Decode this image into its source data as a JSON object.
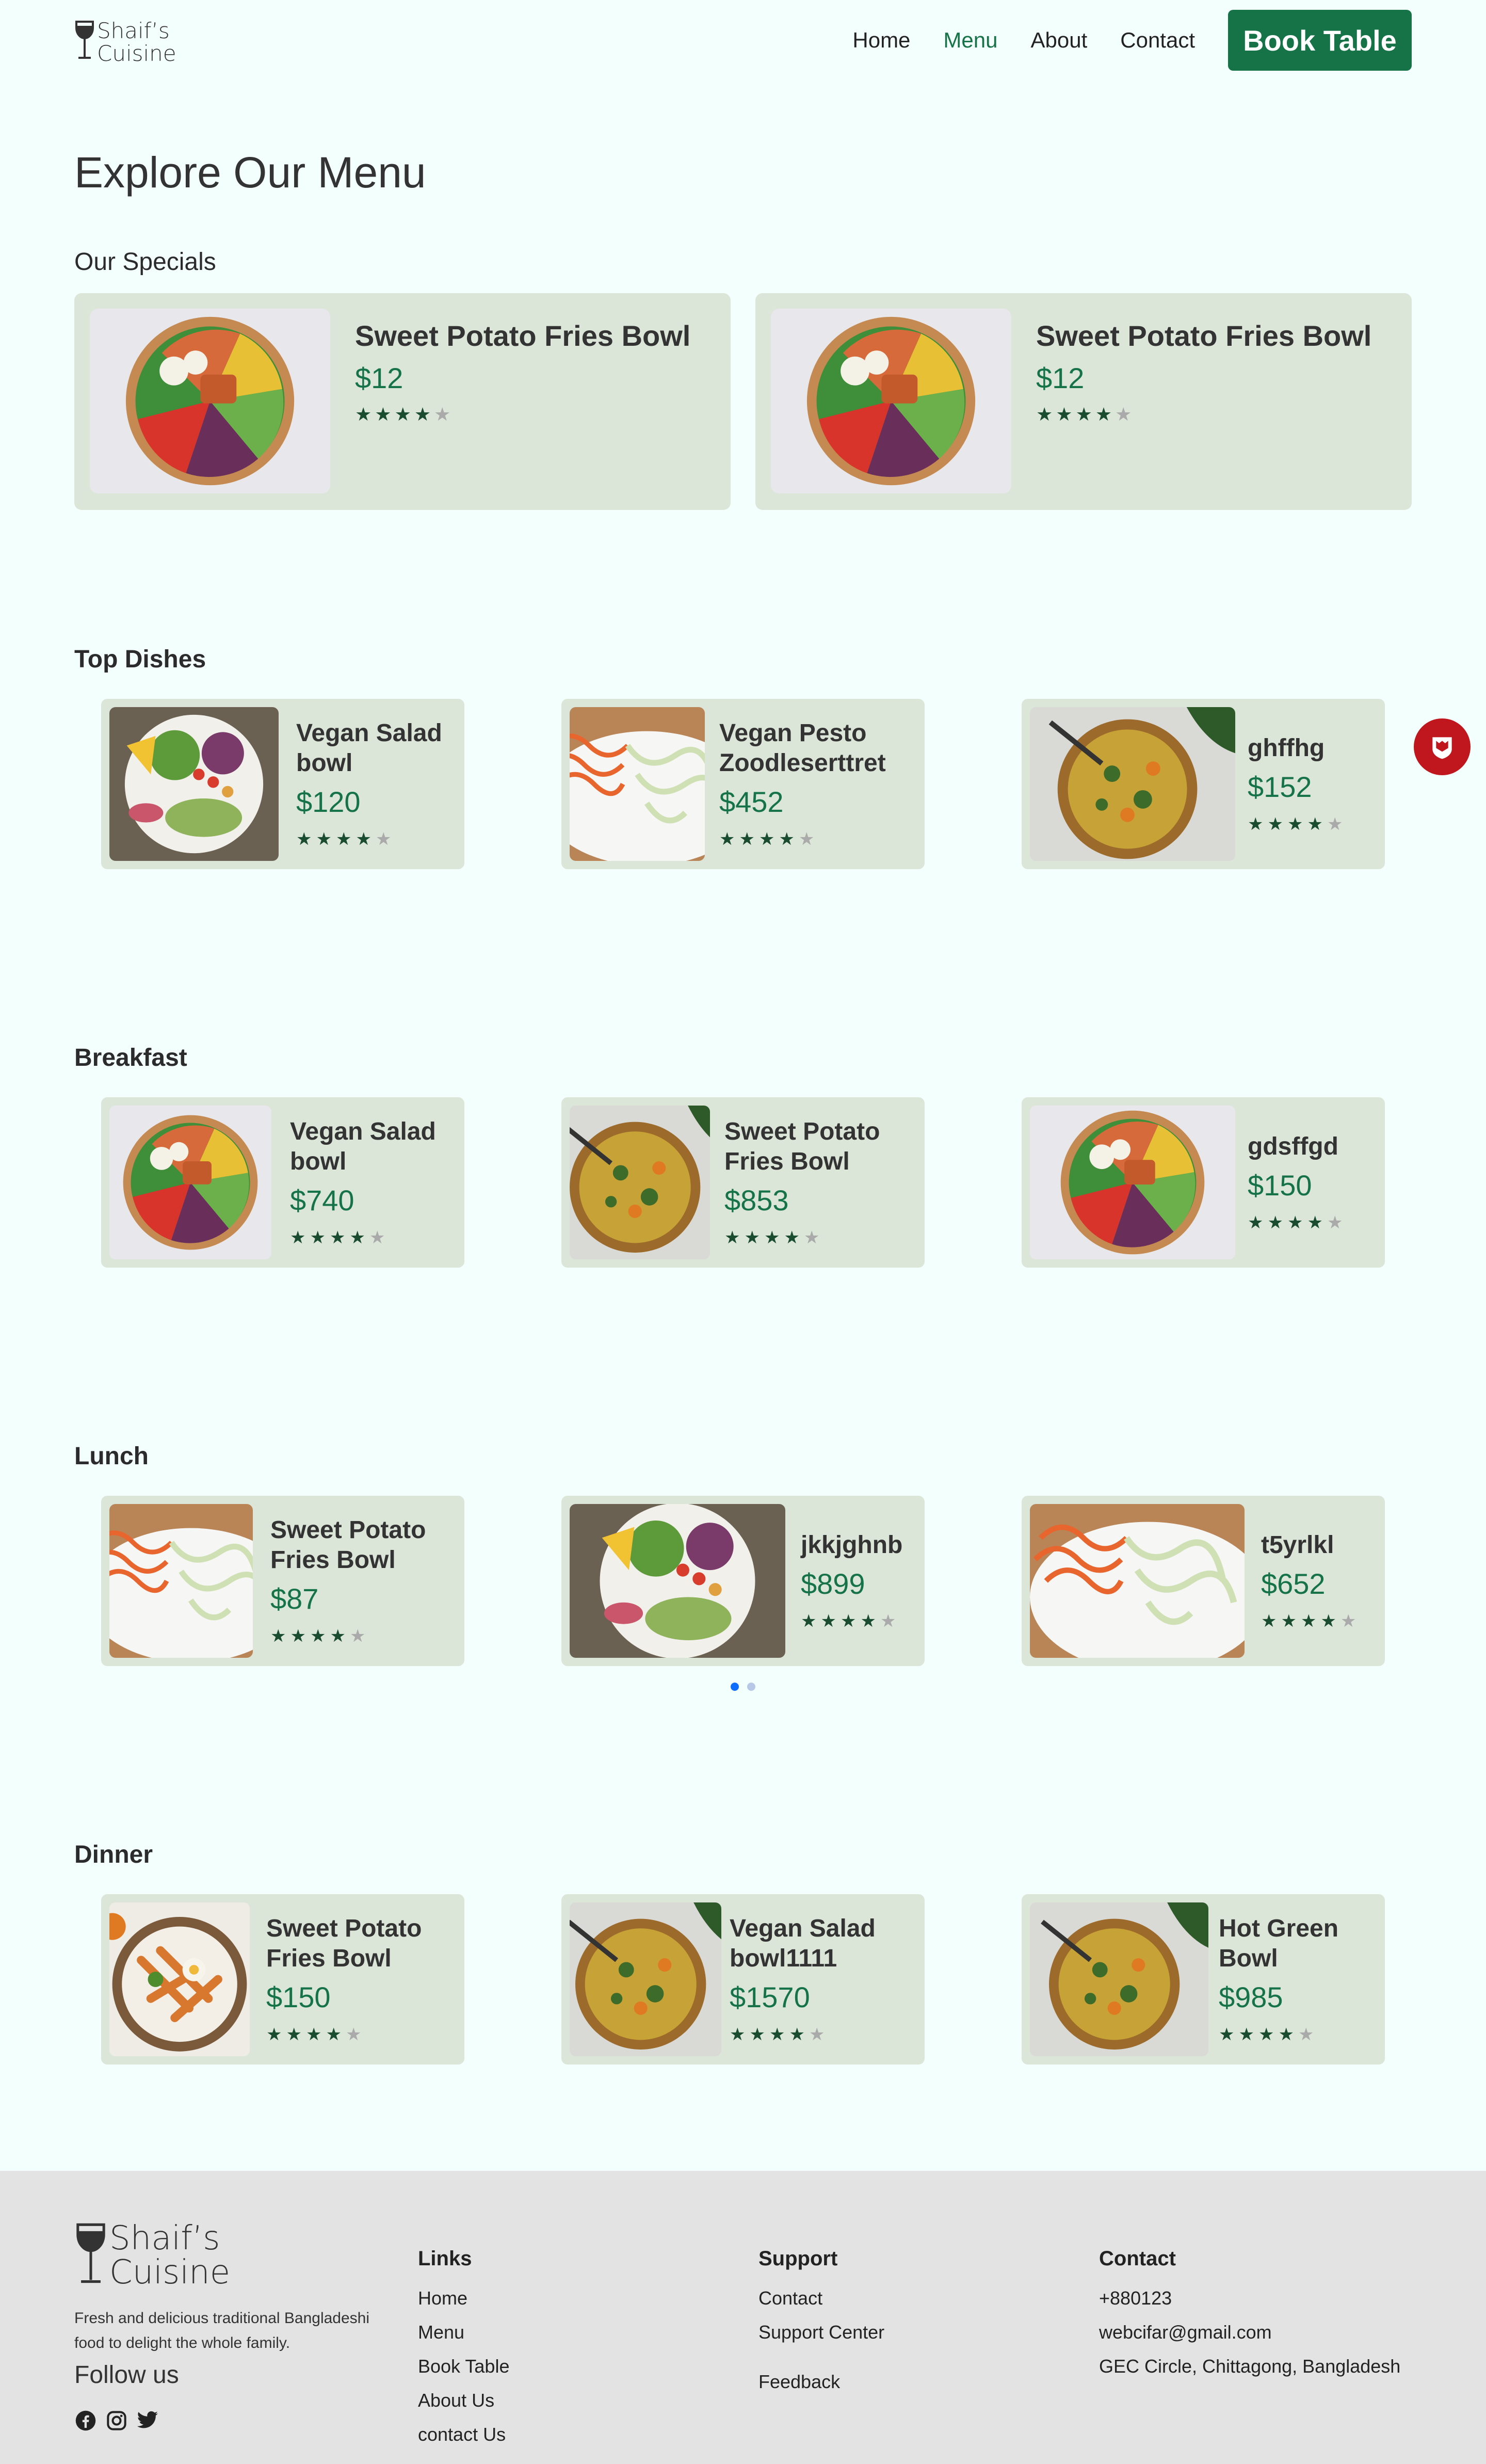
{
  "header": {
    "logo_text_line1": "Shaif’s",
    "logo_text_line2": "Cuisine",
    "nav": [
      {
        "label": "Home",
        "active": false
      },
      {
        "label": "Menu",
        "active": true
      },
      {
        "label": "About",
        "active": false
      },
      {
        "label": "Contact",
        "active": false
      }
    ],
    "book_button": "Book Table"
  },
  "page_title": "Explore Our Menu",
  "specials": {
    "label": "Our Specials",
    "items": [
      {
        "name": "Sweet Potato Fries Bowl",
        "price": "$12",
        "rating": 4,
        "image": "salmon-bowl"
      },
      {
        "name": "Sweet Potato Fries Bowl",
        "price": "$12",
        "rating": 4,
        "image": "salmon-bowl"
      }
    ]
  },
  "top_dishes": {
    "label": "Top Dishes",
    "items": [
      {
        "name": "Vegan Salad bowl",
        "price": "$120",
        "rating": 4,
        "image": "avocado-salad"
      },
      {
        "name": "Vegan Pesto Zoodleserttret",
        "price": "$452",
        "rating": 4,
        "image": "zoodles"
      },
      {
        "name": "ghffhg",
        "price": "$152",
        "rating": 4,
        "image": "curry-pan"
      }
    ]
  },
  "breakfast": {
    "label": "Breakfast",
    "items": [
      {
        "name": "Vegan Salad bowl",
        "price": "$740",
        "rating": 4,
        "image": "salmon-bowl"
      },
      {
        "name": "Sweet Potato Fries Bowl",
        "price": "$853",
        "rating": 4,
        "image": "curry-pan"
      },
      {
        "name": "gdsffgd",
        "price": "$150",
        "rating": 4,
        "image": "salmon-bowl"
      }
    ]
  },
  "lunch": {
    "label": "Lunch",
    "items": [
      {
        "name": "Sweet Potato Fries Bowl",
        "price": "$87",
        "rating": 4,
        "image": "zoodles"
      },
      {
        "name": "jkkjghnb",
        "price": "$899",
        "rating": 4,
        "image": "avocado-salad"
      },
      {
        "name": "t5yrlkl",
        "price": "$652",
        "rating": 4,
        "image": "zoodles"
      }
    ]
  },
  "dinner": {
    "label": "Dinner",
    "items": [
      {
        "name": "Sweet Potato Fries Bowl",
        "price": "$150",
        "rating": 4,
        "image": "fries-plate"
      },
      {
        "name": "Vegan Salad bowl1111",
        "price": "$1570",
        "rating": 4,
        "image": "curry-pan"
      },
      {
        "name": "Hot Green Bowl",
        "price": "$985",
        "rating": 4,
        "image": "curry-pan"
      }
    ]
  },
  "carousel": {
    "active_dot": 0,
    "dot_count": 2
  },
  "footer": {
    "logo_line1": "Shaif’s",
    "logo_line2": "Cuisine",
    "description": "Fresh and delicious traditional Bangladeshi food to delight the whole family.",
    "follow_label": "Follow us",
    "social_icons": [
      "facebook-icon",
      "instagram-icon",
      "twitter-icon"
    ],
    "links": {
      "title": "Links",
      "items": [
        "Home",
        "Menu",
        "Book Table",
        "About Us",
        "contact Us"
      ]
    },
    "support": {
      "title": "Support",
      "items": [
        "Contact",
        "Support Center",
        "Feedback"
      ]
    },
    "contact": {
      "title": "Contact",
      "items": [
        "+880123",
        "webcifar@gmail.com",
        "GEC Circle, Chittagong, Bangladesh"
      ]
    }
  },
  "colors": {
    "accent": "#157347",
    "card": "#dbe6d9",
    "background": "#f3fffd",
    "footer": "#e3e3e3"
  }
}
